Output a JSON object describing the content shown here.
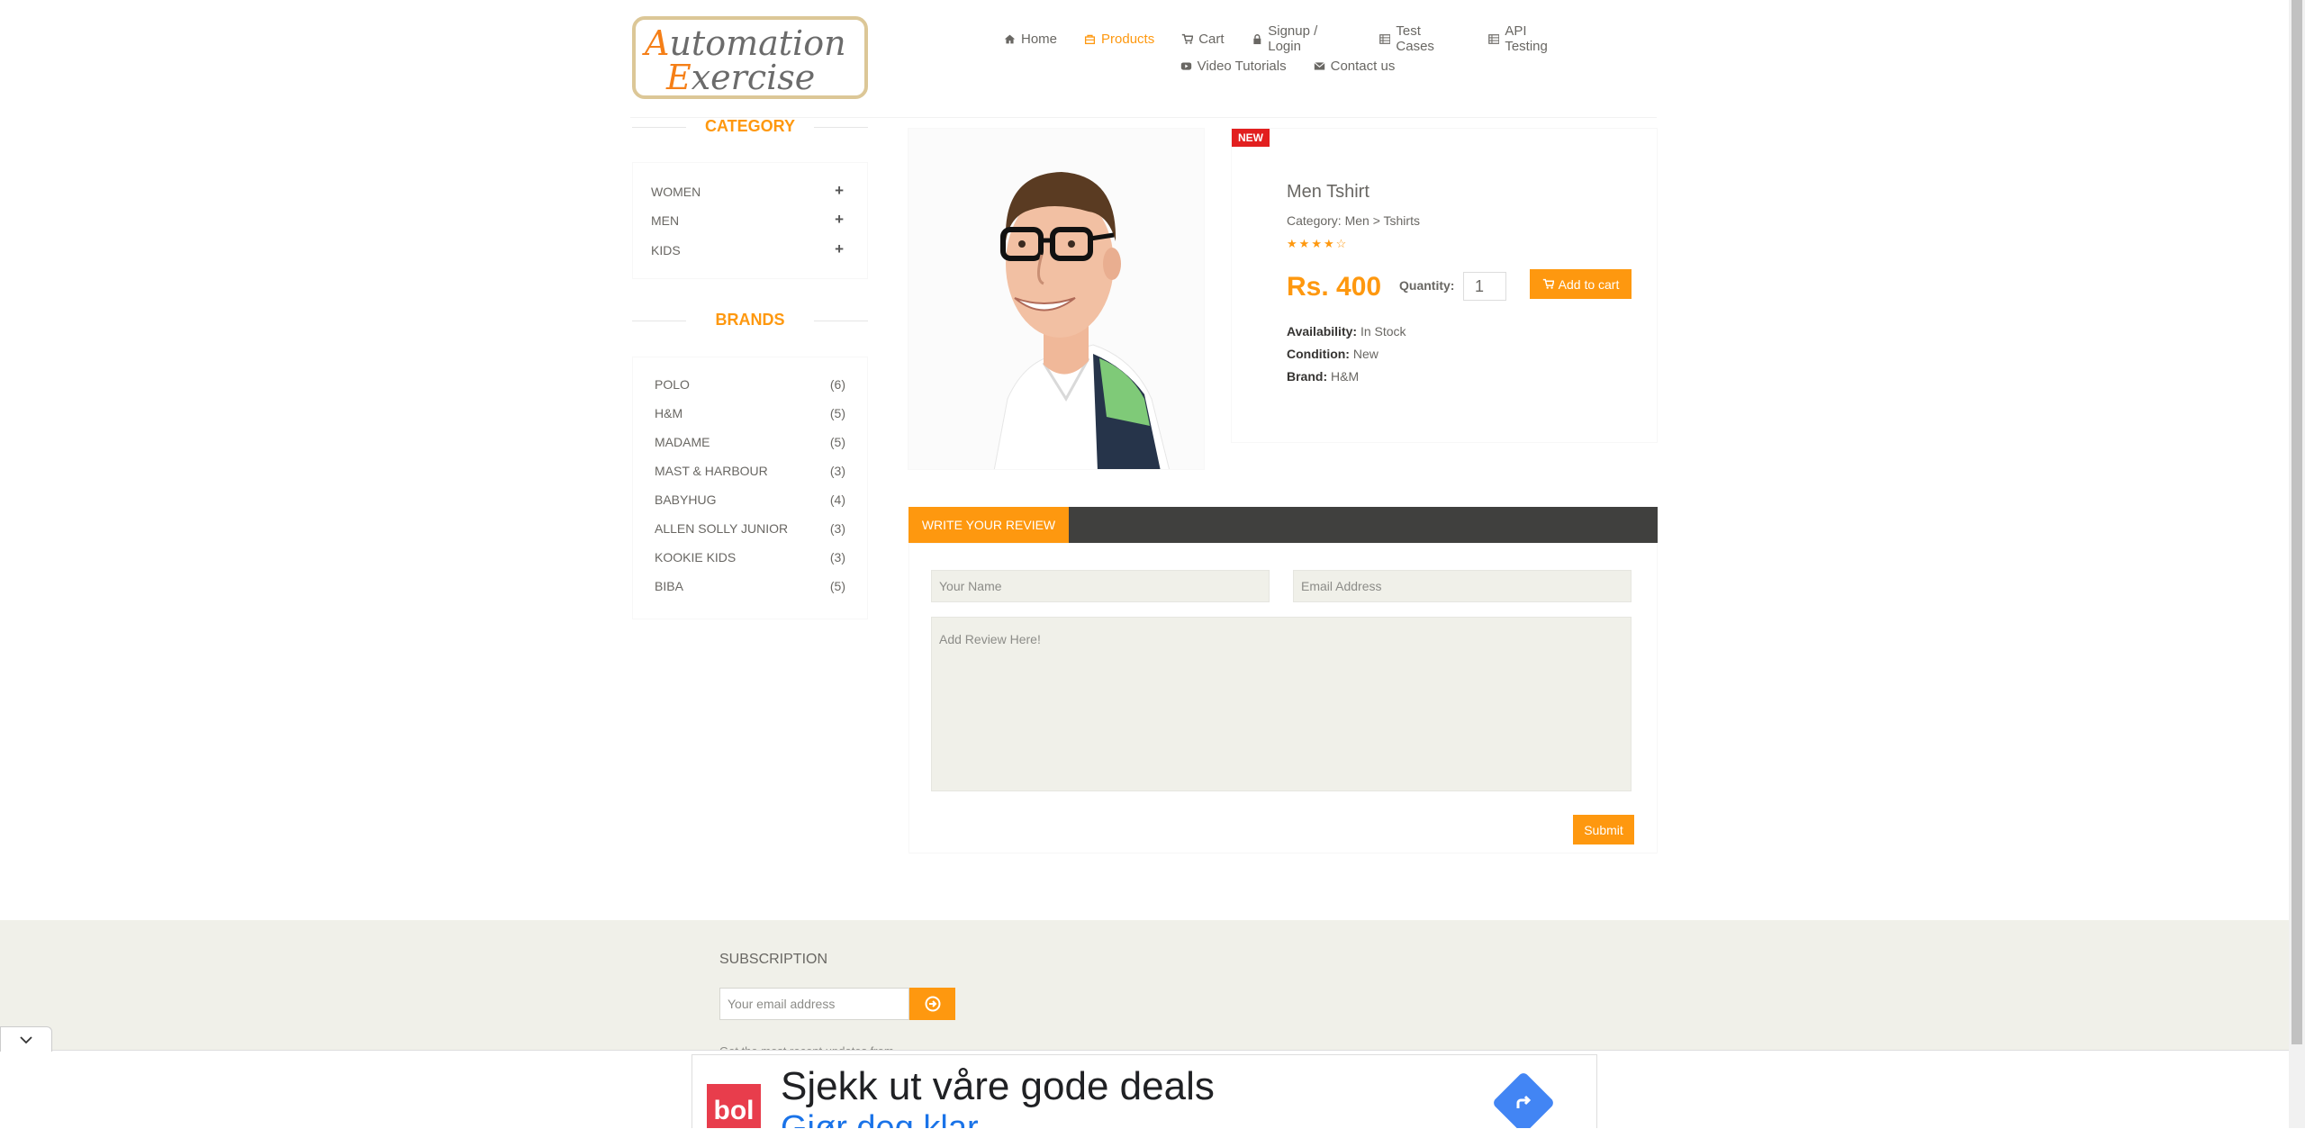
{
  "header": {
    "logo_line1": "Automation",
    "logo_line2": "Exercise",
    "nav": [
      {
        "label": "Home",
        "icon": "home-icon"
      },
      {
        "label": "Products",
        "icon": "products-icon",
        "active": true
      },
      {
        "label": "Cart",
        "icon": "cart-icon"
      },
      {
        "label": "Signup / Login",
        "icon": "lock-icon"
      },
      {
        "label": "Test Cases",
        "icon": "list-icon"
      },
      {
        "label": "API Testing",
        "icon": "list-icon"
      },
      {
        "label": "Video Tutorials",
        "icon": "youtube-icon"
      },
      {
        "label": "Contact us",
        "icon": "envelope-icon"
      }
    ]
  },
  "sidebar": {
    "category_title": "CATEGORY",
    "categories": [
      "WOMEN",
      "MEN",
      "KIDS"
    ],
    "brands_title": "BRANDS",
    "brands": [
      {
        "name": "POLO",
        "count": "(6)"
      },
      {
        "name": "H&M",
        "count": "(5)"
      },
      {
        "name": "MADAME",
        "count": "(5)"
      },
      {
        "name": "MAST & HARBOUR",
        "count": "(3)"
      },
      {
        "name": "BABYHUG",
        "count": "(4)"
      },
      {
        "name": "ALLEN SOLLY JUNIOR",
        "count": "(3)"
      },
      {
        "name": "KOOKIE KIDS",
        "count": "(3)"
      },
      {
        "name": "BIBA",
        "count": "(5)"
      }
    ]
  },
  "product": {
    "badge": "NEW",
    "name": "Men Tshirt",
    "category": "Category: Men > Tshirts",
    "rating": 4.5,
    "price": "Rs. 400",
    "quantity_label": "Quantity:",
    "quantity_value": "1",
    "add_to_cart": "Add to cart",
    "availability_label": "Availability:",
    "availability_value": "In Stock",
    "condition_label": "Condition:",
    "condition_value": "New",
    "brand_label": "Brand:",
    "brand_value": "H&M"
  },
  "review": {
    "tab": "WRITE YOUR REVIEW",
    "name_placeholder": "Your Name",
    "email_placeholder": "Email Address",
    "review_placeholder": "Add Review Here!",
    "submit": "Submit"
  },
  "footer": {
    "subscription_title": "SUBSCRIPTION",
    "email_placeholder": "Your email address",
    "note": "Get the most recent updates from"
  },
  "ad": {
    "logo": "bol",
    "headline": "Sjekk ut våre gode deals",
    "subline": "Gjør deg klar"
  },
  "colors": {
    "accent": "#fe980f",
    "dark_bar": "#40403e",
    "footer_bg": "#f0f0e9",
    "badge_red": "#e21f1f"
  }
}
